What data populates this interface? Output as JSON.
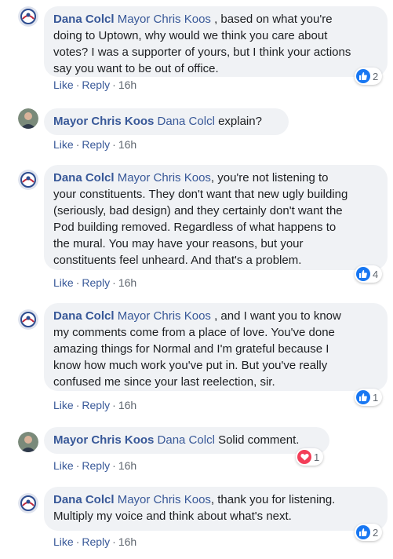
{
  "comments": [
    {
      "author": "Dana Colcl",
      "mention": "Mayor Chris Koos",
      "lines": [
        " , based on what you're",
        "doing to Uptown, why would we think you care about",
        "votes? I was a supporter of yours, but I think your actions",
        "say you want to be out of office."
      ],
      "like_label": "Like",
      "reply_label": "Reply",
      "time": "16h",
      "reaction": "like",
      "reaction_count": "2"
    },
    {
      "author": "Mayor Chris Koos",
      "mention": "Dana Colcl",
      "lines": [
        " explain?"
      ],
      "like_label": "Like",
      "reply_label": "Reply",
      "time": "16h"
    },
    {
      "author": "Dana Colcl",
      "mention": "Mayor Chris Koos",
      "lines": [
        ", you're not listening to",
        "your constituents. They don't want that new ugly building",
        "(seriously, bad design) and they certainly don't want the",
        "Pod building removed. Regardless of what happens to",
        "the mural. You may have your reasons, but your",
        "constituents feel unheard. And that's a problem."
      ],
      "like_label": "Like",
      "reply_label": "Reply",
      "time": "16h",
      "reaction": "like",
      "reaction_count": "4"
    },
    {
      "author": "Dana Colcl",
      "mention": "Mayor Chris Koos",
      "lines": [
        " , and I want you to know",
        "my comments come from a place of love. You've done",
        "amazing things for Normal and I'm grateful because I",
        "know how much work you've put in. But you've really",
        "confused me since your last reelection, sir."
      ],
      "like_label": "Like",
      "reply_label": "Reply",
      "time": "16h",
      "reaction": "like",
      "reaction_count": "1"
    },
    {
      "author": "Mayor Chris Koos",
      "mention": "Dana Colcl",
      "lines": [
        " Solid comment."
      ],
      "like_label": "Like",
      "reply_label": "Reply",
      "time": "16h",
      "reaction": "love",
      "reaction_count": "1"
    },
    {
      "author": "Dana Colcl",
      "mention": "Mayor Chris Koos",
      "lines": [
        ", thank you for listening.",
        "Multiply my voice and think about what's next."
      ],
      "like_label": "Like",
      "reply_label": "Reply",
      "time": "16h",
      "reaction": "like",
      "reaction_count": "2"
    }
  ],
  "colors": {
    "link": "#385898",
    "bubble": "#f0f2f5",
    "meta": "#606770",
    "like": "#1877f2",
    "love": "#f33e58"
  },
  "icons": {
    "like": "thumbs-up-icon",
    "love": "heart-icon"
  }
}
